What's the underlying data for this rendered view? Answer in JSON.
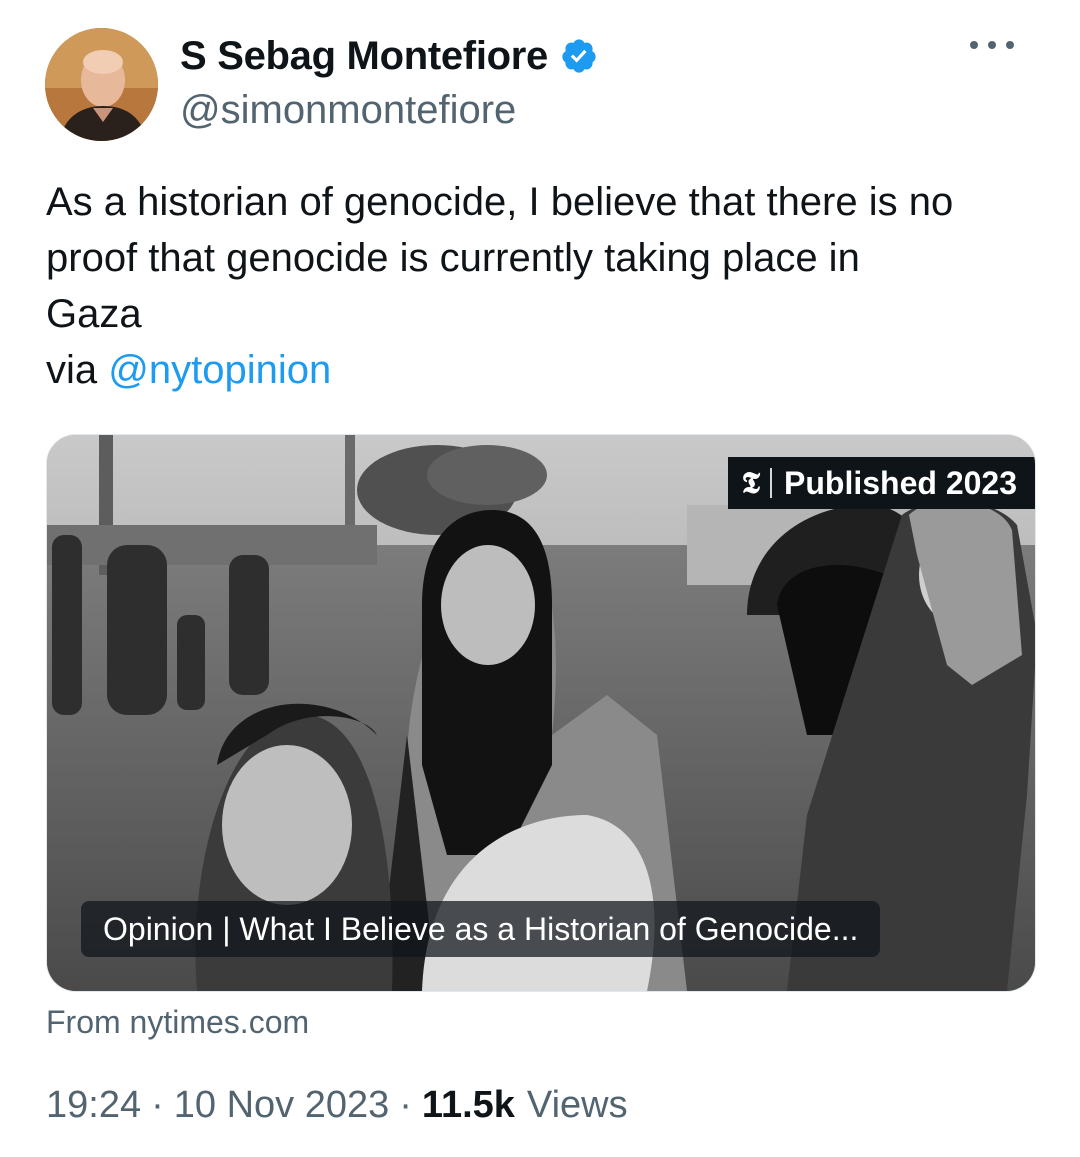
{
  "author": {
    "name": "S Sebag Montefiore",
    "handle": "@simonmontefiore",
    "verified_color": "#1d9bf0"
  },
  "tweet": {
    "text": "As a historian of genocide, I believe that there is no\nproof that genocide is currently taking place in\nGaza",
    "via_prefix": "via ",
    "mention": "@nytopinion"
  },
  "card": {
    "badge_logo": "𝕿",
    "badge_text": "Published 2023",
    "caption": "Opinion | What I Believe as a Historian of Genocide...",
    "source": "From nytimes.com"
  },
  "meta": {
    "time": "19:24",
    "separator": "·",
    "date": "10 Nov 2023",
    "views_count": "11.5k",
    "views_label": "Views"
  },
  "icons": {
    "verified": "verified-badge-icon",
    "more": "more-options-icon",
    "nyt": "nyt-logo-icon"
  },
  "colors": {
    "link": "#1d9bf0",
    "secondary_text": "#536471",
    "primary_text": "#0f1419"
  }
}
